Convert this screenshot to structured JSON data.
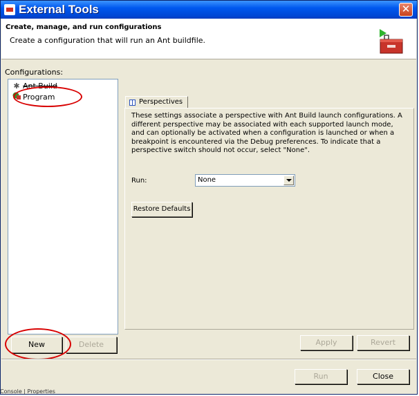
{
  "window": {
    "title": "External Tools",
    "close_glyph": "✕"
  },
  "banner": {
    "title": "Create, manage, and run configurations",
    "message": "Create a configuration that will run an Ant buildfile."
  },
  "configurations": {
    "label": "Configurations:",
    "items": [
      {
        "label": "Ant Build",
        "icon": "ant-icon"
      },
      {
        "label": "Program",
        "icon": "program-icon"
      }
    ]
  },
  "tab": {
    "label": "Perspectives"
  },
  "perspectives": {
    "description": "These settings associate a perspective with Ant Build launch configurations. A different perspective may be associated with each supported launch mode, and can optionally be activated when a configuration is launched or when a breakpoint is encountered via the Debug preferences. To indicate that a perspective switch should not occur, select \"None\".",
    "run_label": "Run:",
    "run_value": "None",
    "restore_defaults": "Restore Defaults"
  },
  "buttons": {
    "new": "New",
    "delete": "Delete",
    "apply": "Apply",
    "revert": "Revert",
    "run": "Run",
    "close": "Close"
  },
  "annotation": {
    "color": "#d80000"
  },
  "status_bar": {
    "text": "Console | Properties"
  }
}
